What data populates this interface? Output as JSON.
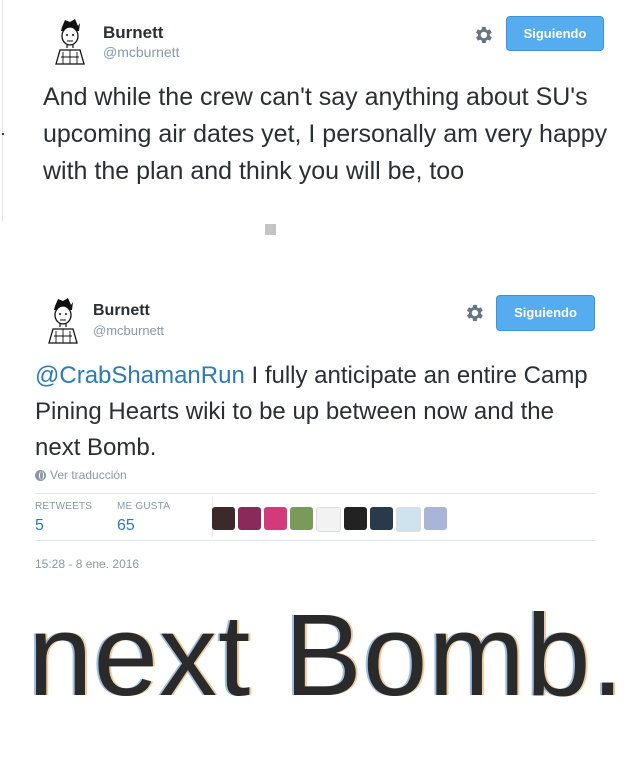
{
  "tweet1": {
    "name": "Burnett",
    "handle": "@mcburnett",
    "follow_label": "Siguiendo",
    "text": "And while the crew can't say anything about SU's upcoming air dates yet, I personally am very happy with the plan and think you will be, too"
  },
  "tweet2": {
    "name": "Burnett",
    "handle": "@mcburnett",
    "follow_label": "Siguiendo",
    "mention": "@CrabShamanRun",
    "text": " I fully anticipate an entire Camp Pining Hearts wiki to be up between now and the next Bomb.",
    "translate_label": "Ver traducción",
    "retweets_label": "RETWEETS",
    "retweets_count": "5",
    "likes_label": "ME GUSTA",
    "likes_count": "65",
    "timestamp": "15:28 - 8 ene. 2016",
    "liker_colors": [
      "#3a2a2a",
      "#8a2a5a",
      "#d23a7a",
      "#7a9a5a",
      "#f2f2f2",
      "#222222",
      "#2a3a4a",
      "#cfe3ee",
      "#a9b4d6"
    ]
  },
  "zoom_text": "next Bomb.",
  "colors": {
    "follow_bg": "#55acee",
    "link": "#2b7bb9",
    "muted": "#8899a6"
  }
}
